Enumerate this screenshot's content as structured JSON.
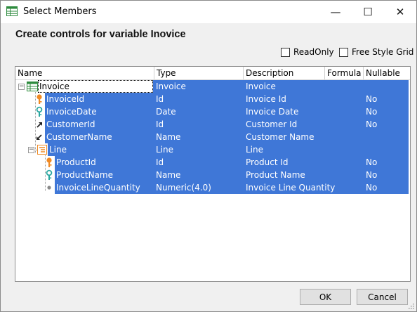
{
  "window": {
    "title": "Select Members",
    "minimize_glyph": "—",
    "maximize_glyph": "☐",
    "close_glyph": "✕"
  },
  "heading": "Create controls for variable Inovice",
  "options": {
    "readonly_label": "ReadOnly",
    "readonly_checked": false,
    "freestyle_label": "Free Style Grid",
    "freestyle_checked": false
  },
  "grid": {
    "columns": [
      "Name",
      "Type",
      "Description",
      "Formula",
      "Nullable"
    ],
    "rows": [
      {
        "name": "Invoice",
        "type": "Invoice",
        "description": "Invoice",
        "formula": "",
        "nullable": "",
        "icon": "level-icon",
        "expander": "⊟"
      },
      {
        "name": "InvoiceId",
        "type": "Id",
        "description": "Invoice Id",
        "formula": "",
        "nullable": "No",
        "icon": "primary-key-icon"
      },
      {
        "name": "InvoiceDate",
        "type": "Date",
        "description": "Invoice Date",
        "formula": "",
        "nullable": "No",
        "icon": "candidate-key-icon"
      },
      {
        "name": "CustomerId",
        "type": "Id",
        "description": "Customer Id",
        "formula": "",
        "nullable": "No",
        "icon": "foreign-key-icon"
      },
      {
        "name": "CustomerName",
        "type": "Name",
        "description": "Customer Name",
        "formula": "",
        "nullable": "",
        "icon": "inferred-attribute-icon"
      },
      {
        "name": "Line",
        "type": "Line",
        "description": "Line",
        "formula": "",
        "nullable": "",
        "icon": "sublevel-icon",
        "expander": "⊟"
      },
      {
        "name": "ProductId",
        "type": "Id",
        "description": "Product Id",
        "formula": "",
        "nullable": "No",
        "icon": "primary-key-icon"
      },
      {
        "name": "ProductName",
        "type": "Name",
        "description": "Product Name",
        "formula": "",
        "nullable": "No",
        "icon": "candidate-key-icon"
      },
      {
        "name": "InvoiceLineQuantity",
        "type": "Numeric(4.0)",
        "description": "Invoice Line Quantity",
        "formula": "",
        "nullable": "No",
        "icon": "attribute-dot-icon"
      }
    ]
  },
  "buttons": {
    "ok": "OK",
    "cancel": "Cancel"
  },
  "colors": {
    "selection": "#3f77d7",
    "key_orange": "#f08a24",
    "candidate_teal": "#2aa7a0"
  }
}
